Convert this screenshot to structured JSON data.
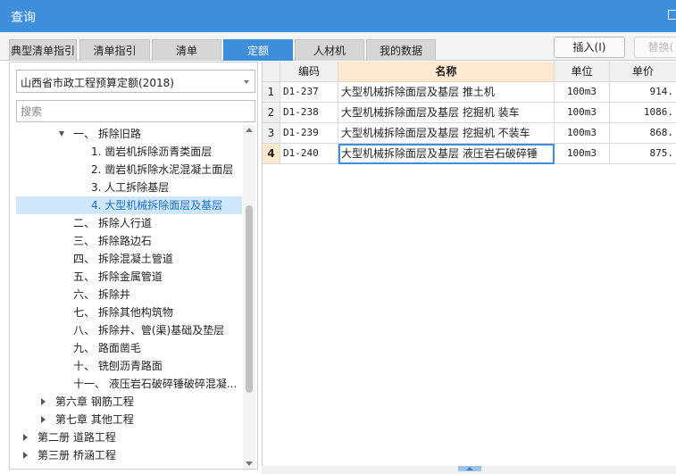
{
  "window": {
    "title": "查询"
  },
  "tabs": [
    {
      "label": "典型清单指引"
    },
    {
      "label": "清单指引"
    },
    {
      "label": "清单"
    },
    {
      "label": "定额"
    },
    {
      "label": "人材机"
    },
    {
      "label": "我的数据"
    }
  ],
  "actions": {
    "insert_label": "插入(I)",
    "replace_label": "替换("
  },
  "library_select": {
    "value": "山西省市政工程预算定额(2018)"
  },
  "search": {
    "placeholder": "搜索"
  },
  "tree": [
    {
      "label": "一、 拆除旧路"
    },
    {
      "label": "1. 凿岩机拆除沥青类面层"
    },
    {
      "label": "2. 凿岩机拆除水泥混凝土面层"
    },
    {
      "label": "3. 人工拆除基层"
    },
    {
      "label": "4. 大型机械拆除面层及基层"
    },
    {
      "label": "二、 拆除人行道"
    },
    {
      "label": "三、 拆除路边石"
    },
    {
      "label": "四、 拆除混凝土管道"
    },
    {
      "label": "五、 拆除金属管道"
    },
    {
      "label": "六、 拆除井"
    },
    {
      "label": "七、 拆除其他构筑物"
    },
    {
      "label": "八、 拆除井、管(渠)基础及垫层"
    },
    {
      "label": "九、 路面凿毛"
    },
    {
      "label": "十、 铣刨沥青路面"
    },
    {
      "label": "十一、 液压岩石破碎锤破碎混凝..."
    },
    {
      "label": "第六章 钢筋工程"
    },
    {
      "label": "第七章 其他工程"
    },
    {
      "label": "第二册 道路工程"
    },
    {
      "label": "第三册 桥涵工程"
    }
  ],
  "table": {
    "columns": [
      "编码",
      "名称",
      "单位",
      "单价"
    ],
    "rows": [
      {
        "no": "1",
        "code": "D1-237",
        "name": "大型机械拆除面层及基层 推土机",
        "unit": "100m3",
        "price": "914."
      },
      {
        "no": "2",
        "code": "D1-238",
        "name": "大型机械拆除面层及基层 挖掘机 装车",
        "unit": "100m3",
        "price": "1086."
      },
      {
        "no": "3",
        "code": "D1-239",
        "name": "大型机械拆除面层及基层 挖掘机 不装车",
        "unit": "100m3",
        "price": "868."
      },
      {
        "no": "4",
        "code": "D1-240",
        "name": "大型机械拆除面层及基层 液压岩石破碎锤",
        "unit": "100m3",
        "price": "875."
      }
    ]
  },
  "colors": {
    "accent": "#3e8edb",
    "selection": "#cfe7fb",
    "header_highlight": "#fde9cf"
  }
}
